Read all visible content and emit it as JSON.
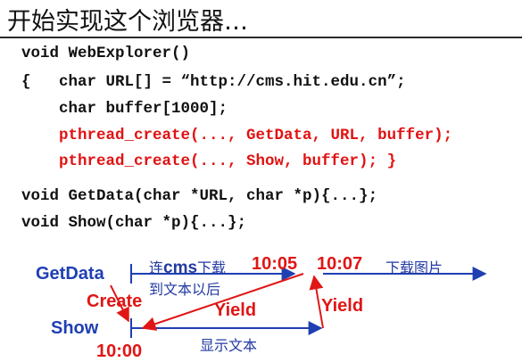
{
  "slide": {
    "title": "开始实现这个浏览器…"
  },
  "code": {
    "line1": "void WebExplorer()",
    "line2": "{   char URL[] = “http://cms.hit.edu.cn”;",
    "line3": "    char buffer[1000];",
    "line4": "    pthread_create(..., GetData, URL, buffer);",
    "line5": "    pthread_create(..., Show, buffer); }",
    "line6": "void GetData(char *URL, char *p){...};",
    "line7": "void Show(char *p){...};"
  },
  "diagram": {
    "getdata_label": "GetData",
    "show_label": "Show",
    "create_label": "Create",
    "yield_left": "Yield",
    "yield_right": "Yield",
    "time_1000": "10:00",
    "time_1005": "10:05",
    "time_1007": "10:07",
    "text_connect_prefix": "连",
    "text_cms": "cms",
    "text_download": "下载",
    "text_to_text_later": "到文本以后",
    "text_download_images": "下载图片",
    "text_show_text": "显示文本",
    "colors": {
      "blue": "#1f3fb2",
      "red": "#e01616"
    }
  }
}
